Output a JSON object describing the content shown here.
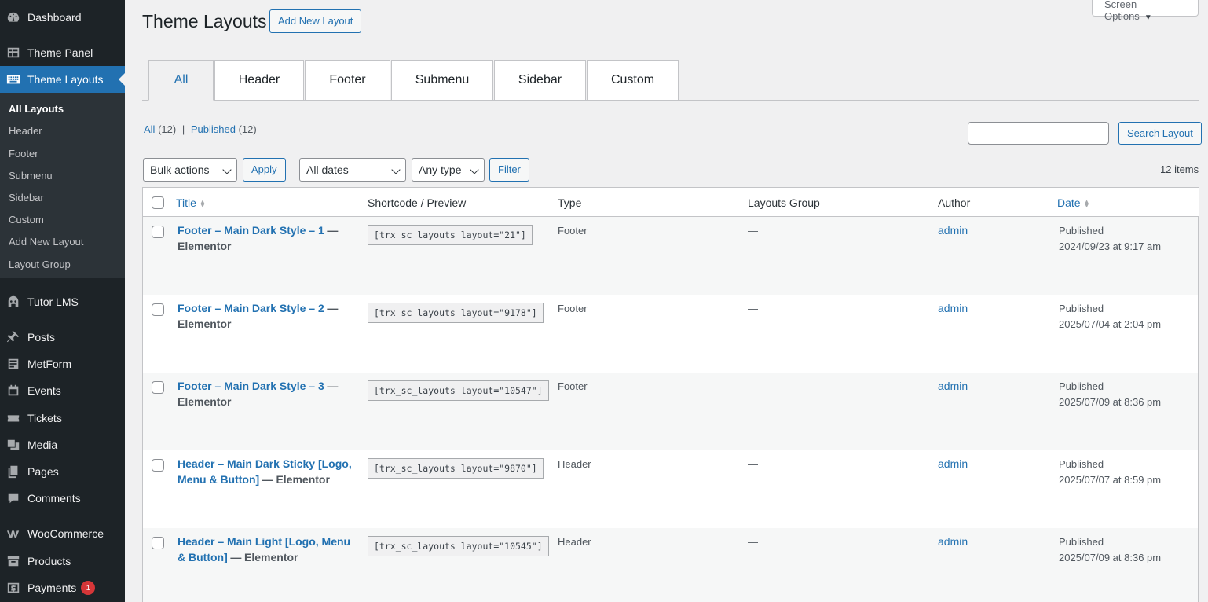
{
  "sidebar": {
    "items": [
      {
        "label": "Dashboard",
        "icon": "dashboard-icon"
      },
      {
        "label": "Theme Panel",
        "icon": "grid-icon"
      },
      {
        "label": "Theme Layouts",
        "icon": "keyboard-icon"
      },
      {
        "label": "Tutor LMS",
        "icon": "tutor-icon"
      },
      {
        "label": "Posts",
        "icon": "pin-icon"
      },
      {
        "label": "MetForm",
        "icon": "form-icon"
      },
      {
        "label": "Events",
        "icon": "events-icon"
      },
      {
        "label": "Tickets",
        "icon": "ticket-icon"
      },
      {
        "label": "Media",
        "icon": "media-icon"
      },
      {
        "label": "Pages",
        "icon": "pages-icon"
      },
      {
        "label": "Comments",
        "icon": "comment-icon"
      },
      {
        "label": "WooCommerce",
        "icon": "woo-icon"
      },
      {
        "label": "Products",
        "icon": "archive-icon"
      },
      {
        "label": "Payments",
        "icon": "dollar-icon",
        "badge": "1"
      }
    ],
    "submenu": [
      "All Layouts",
      "Header",
      "Footer",
      "Submenu",
      "Sidebar",
      "Custom",
      "Add New Layout",
      "Layout Group"
    ]
  },
  "header": {
    "title": "Theme Layouts",
    "add_new": "Add New Layout",
    "screen_options": "Screen Options"
  },
  "tabs": [
    "All",
    "Header",
    "Footer",
    "Submenu",
    "Sidebar",
    "Custom"
  ],
  "views": {
    "all_label": "All",
    "all_count": "(12)",
    "published_label": "Published",
    "published_count": "(12)",
    "separator": "|"
  },
  "search": {
    "button": "Search Layout",
    "value": ""
  },
  "filters": {
    "bulk_actions": "Bulk actions",
    "apply": "Apply",
    "dates": "All dates",
    "type": "Any type",
    "filter": "Filter",
    "items_count": "12 items"
  },
  "table": {
    "columns": [
      "Title",
      "Shortcode / Preview",
      "Type",
      "Layouts Group",
      "Author",
      "Date"
    ],
    "rows": [
      {
        "title": "Footer – Main Dark Style – 1",
        "state": "Elementor",
        "shortcode": "[trx_sc_layouts layout=\"21\"]",
        "type": "Footer",
        "group": "—",
        "author": "admin",
        "status": "Published",
        "date": "2024/09/23 at 9:17 am"
      },
      {
        "title": "Footer – Main Dark Style – 2",
        "state": "Elementor",
        "shortcode": "[trx_sc_layouts layout=\"9178\"]",
        "type": "Footer",
        "group": "—",
        "author": "admin",
        "status": "Published",
        "date": "2025/07/04 at 2:04 pm"
      },
      {
        "title": "Footer – Main Dark Style – 3",
        "state": "Elementor",
        "shortcode": "[trx_sc_layouts layout=\"10547\"]",
        "type": "Footer",
        "group": "—",
        "author": "admin",
        "status": "Published",
        "date": "2025/07/09 at 8:36 pm"
      },
      {
        "title": "Header – Main Dark Sticky [Logo, Menu & Button]",
        "state": "Elementor",
        "shortcode": "[trx_sc_layouts layout=\"9870\"]",
        "type": "Header",
        "group": "—",
        "author": "admin",
        "status": "Published",
        "date": "2025/07/07 at 8:59 pm"
      },
      {
        "title": "Header – Main Light [Logo, Menu & Button]",
        "state": "Elementor",
        "shortcode": "[trx_sc_layouts layout=\"10545\"]",
        "type": "Header",
        "group": "—",
        "author": "admin",
        "status": "Published",
        "date": "2025/07/09 at 8:36 pm"
      }
    ]
  },
  "colors": {
    "accent": "#2271b1",
    "sidebar": "#1d2327",
    "badge": "#d63638"
  }
}
